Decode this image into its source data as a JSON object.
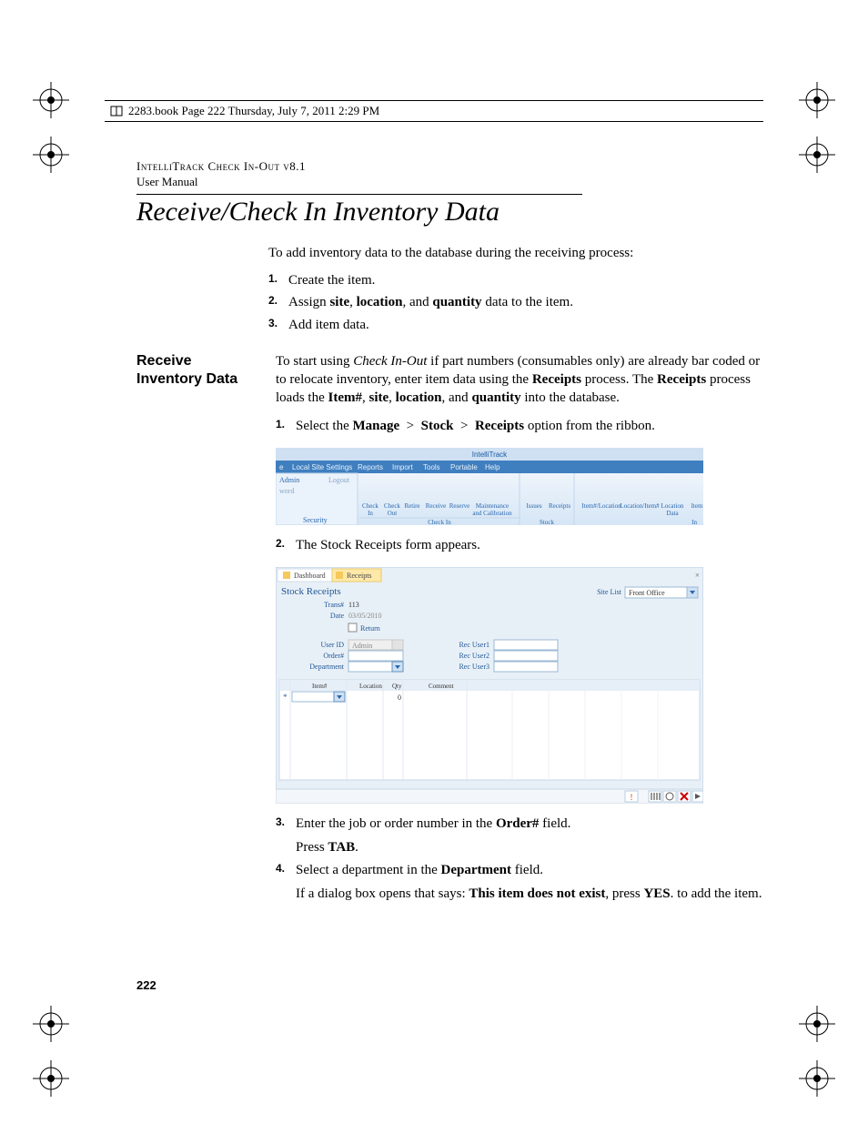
{
  "header": {
    "text": "2283.book  Page 222  Thursday, July 7, 2011  2:29 PM"
  },
  "running_head": {
    "line1": "IntelliTrack Check In-Out v8.1",
    "line2": "User Manual"
  },
  "chapter_title": "Receive/Check In Inventory Data",
  "intro": "To add inventory data to the database during the receiving process:",
  "intro_steps": [
    "Create the item.",
    "Assign site, location, and quantity data to the item.",
    "Add item data."
  ],
  "intro_steps_bold_words": {
    "1": [
      "site",
      "location",
      "quantity"
    ]
  },
  "section": {
    "side_head_line1": "Receive",
    "side_head_line2": "Inventory Data",
    "para": "To start using Check In-Out if part numbers (consumables only) are already bar coded or to relocate inventory, enter item data using the Receipts process. The Receipts process loads the Item#, site, location, and quantity into the database.",
    "steps": {
      "1": "Select the Manage  >  Stock  >  Receipts option from the ribbon.",
      "2": "The Stock Receipts form appears.",
      "3": "Enter the job or order number in the Order# field.",
      "3b": "Press TAB.",
      "4": "Select a department in the Department field.",
      "4b": "If a dialog box opens that says: This item does not exist, press YES. to add the item."
    }
  },
  "ribbon_shot": {
    "title_app": "IntelliTrack",
    "tabs": [
      "e",
      "Local Site Settings",
      "Reports",
      "Import",
      "Tools",
      "Portable",
      "Help"
    ],
    "left_panel": {
      "user": "Admin",
      "word": "word",
      "logout": "Logout",
      "group": "Security"
    },
    "checkin_group": {
      "items": [
        "Check In",
        "Check Out",
        "Retire",
        "Receive",
        "Reserve",
        "Maintenance and Calibration"
      ],
      "label": "Check In"
    },
    "stock_group": {
      "items": [
        "Issues",
        "Receipts"
      ],
      "label": "Stock"
    },
    "right_items": [
      "Item#/Location",
      "Location/Item#",
      "Location Data"
    ],
    "right_group_label": "In",
    "far_item": "Item"
  },
  "form_shot": {
    "tabs": {
      "dashboard": "Dashboard",
      "receipts": "Receipts"
    },
    "title": "Stock Receipts",
    "site_list_label": "Site List",
    "site_list_value": "Front Office",
    "fields": {
      "trans_label": "Trans#",
      "trans_value": "113",
      "date_label": "Date",
      "date_value": "03/05/2010",
      "return_label": "Return",
      "userid_label": "User ID",
      "userid_value": "Admin",
      "order_label": "Order#",
      "department_label": "Department",
      "recuser1": "Rec User1",
      "recuser2": "Rec User2",
      "recuser3": "Rec User3"
    },
    "grid_headers": [
      "Item#",
      "Location",
      "Qty",
      "Comment"
    ]
  },
  "page_number": "222"
}
